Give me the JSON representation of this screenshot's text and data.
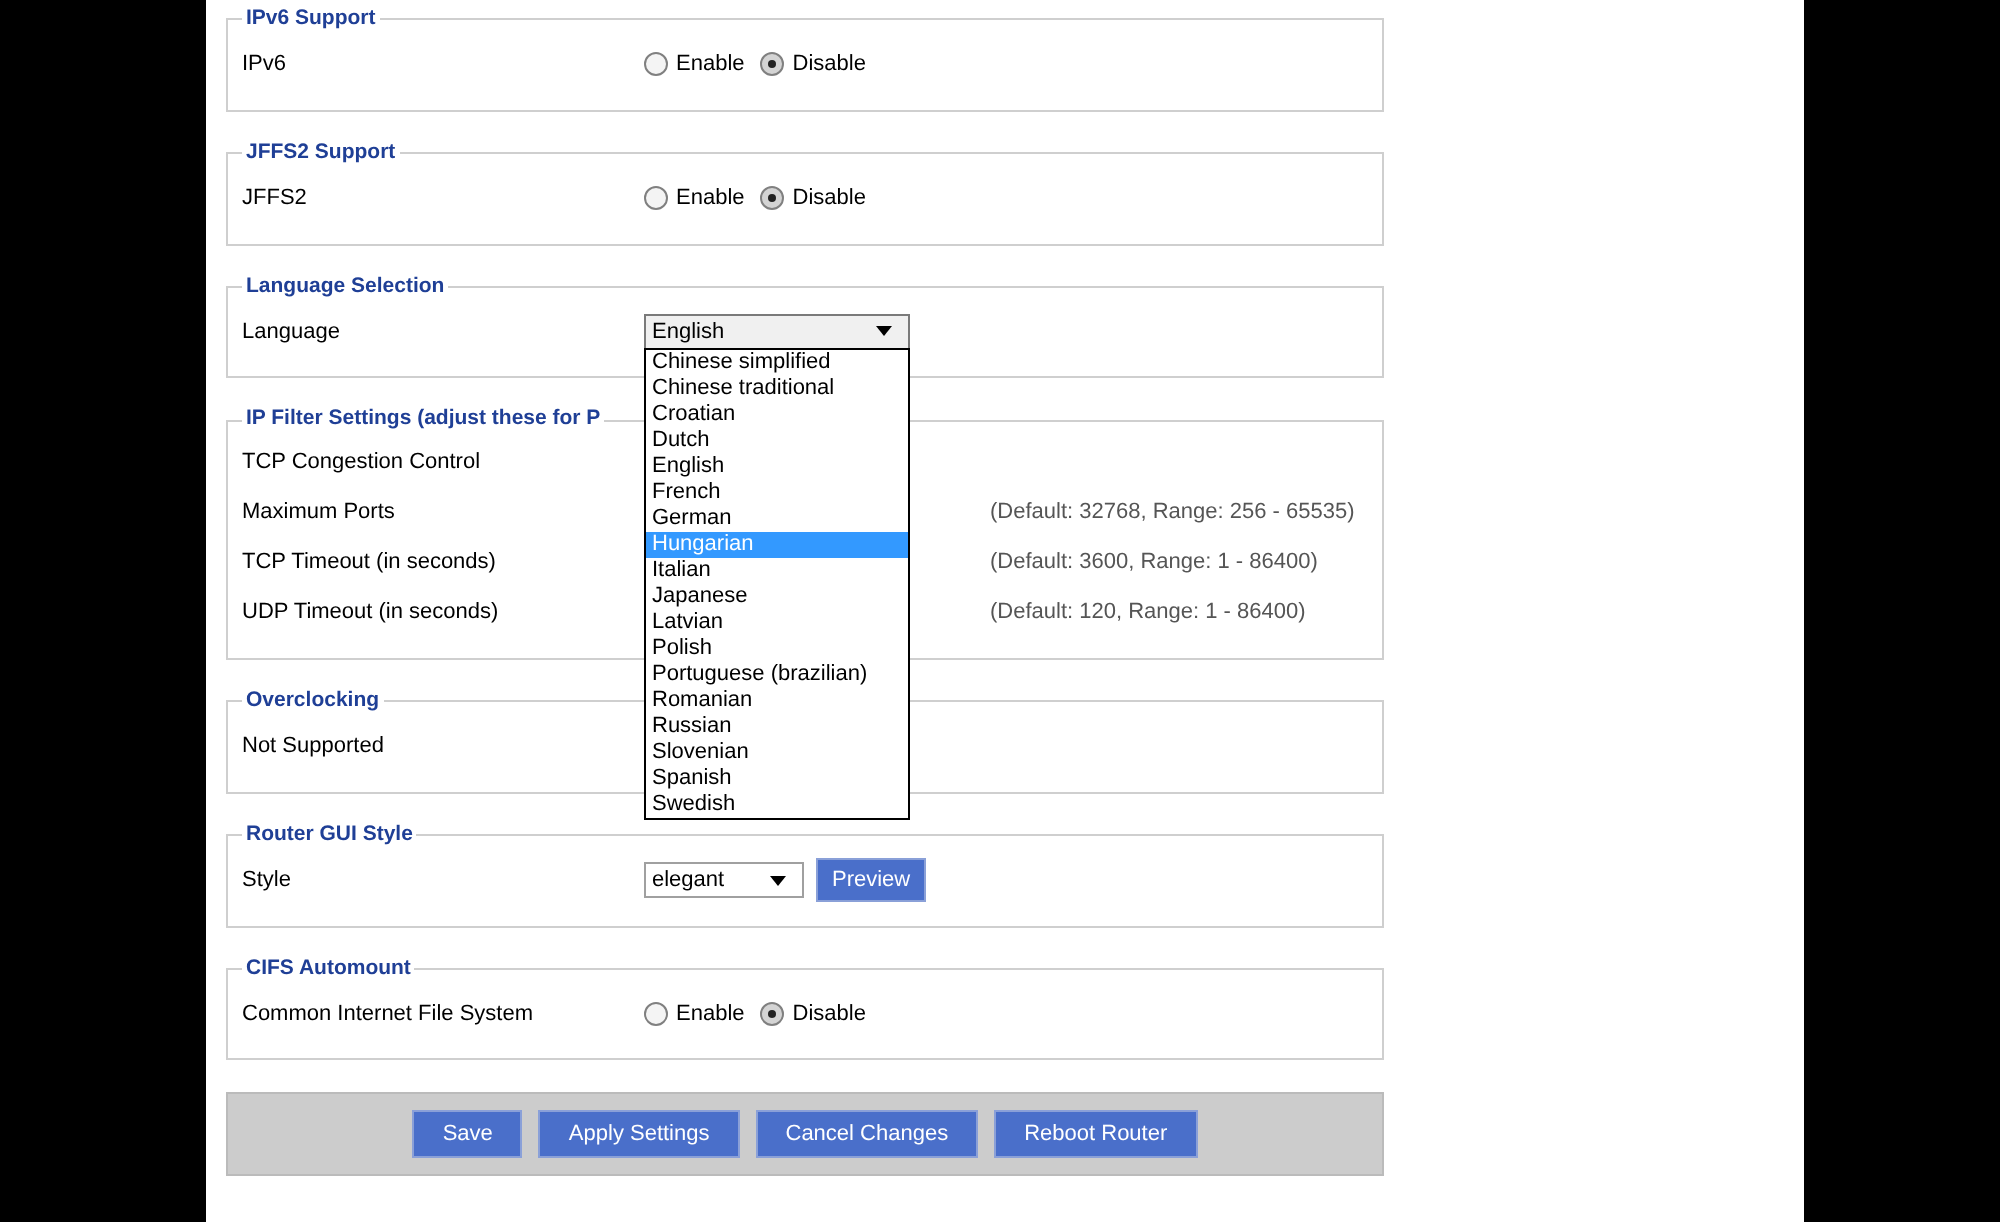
{
  "sections": [
    {
      "legend": "IPv6 Support",
      "rows": [
        {
          "kind": "radio",
          "label": "IPv6",
          "options": [
            {
              "label": "Enable",
              "selected": false
            },
            {
              "label": "Disable",
              "selected": true
            }
          ]
        }
      ]
    },
    {
      "legend": "JFFS2 Support",
      "rows": [
        {
          "kind": "radio",
          "label": "JFFS2",
          "options": [
            {
              "label": "Enable",
              "selected": false
            },
            {
              "label": "Disable",
              "selected": true
            }
          ]
        }
      ]
    },
    {
      "legend": "Language Selection",
      "rows": [
        {
          "kind": "select",
          "label": "Language",
          "value": "English",
          "expanded": true,
          "options": [
            {
              "label": "Chinese simplified",
              "highlighted": false
            },
            {
              "label": "Chinese traditional",
              "highlighted": false
            },
            {
              "label": "Croatian",
              "highlighted": false
            },
            {
              "label": "Dutch",
              "highlighted": false
            },
            {
              "label": "English",
              "highlighted": false
            },
            {
              "label": "French",
              "highlighted": false
            },
            {
              "label": "German",
              "highlighted": false
            },
            {
              "label": "Hungarian",
              "highlighted": true
            },
            {
              "label": "Italian",
              "highlighted": false
            },
            {
              "label": "Japanese",
              "highlighted": false
            },
            {
              "label": "Latvian",
              "highlighted": false
            },
            {
              "label": "Polish",
              "highlighted": false
            },
            {
              "label": "Portuguese (brazilian)",
              "highlighted": false
            },
            {
              "label": "Romanian",
              "highlighted": false
            },
            {
              "label": "Russian",
              "highlighted": false
            },
            {
              "label": "Slovenian",
              "highlighted": false
            },
            {
              "label": "Spanish",
              "highlighted": false
            },
            {
              "label": "Swedish",
              "highlighted": false
            }
          ]
        }
      ]
    },
    {
      "legend": "IP Filter Settings (adjust these for P",
      "rows": [
        {
          "kind": "text",
          "label": "TCP Congestion Control"
        },
        {
          "kind": "hint",
          "label": "Maximum Ports",
          "hint": "(Default: 32768, Range: 256 - 65535)"
        },
        {
          "kind": "hint",
          "label": "TCP Timeout (in seconds)",
          "hint": "(Default: 3600, Range: 1 - 86400)"
        },
        {
          "kind": "hint",
          "label": "UDP Timeout (in seconds)",
          "hint": "(Default: 120, Range: 1 - 86400)"
        }
      ]
    },
    {
      "legend": "Overclocking",
      "rows": [
        {
          "kind": "text",
          "label": "Not Supported"
        }
      ]
    },
    {
      "legend": "Router GUI Style",
      "rows": [
        {
          "kind": "select",
          "label": "Style",
          "value": "elegant",
          "expanded": false,
          "button": "Preview"
        }
      ]
    },
    {
      "legend": "CIFS Automount",
      "rows": [
        {
          "kind": "radio",
          "label": "Common Internet File System",
          "options": [
            {
              "label": "Enable",
              "selected": false
            },
            {
              "label": "Disable",
              "selected": true
            }
          ]
        }
      ]
    }
  ],
  "buttons": [
    "Save",
    "Apply Settings",
    "Cancel Changes",
    "Reboot Router"
  ]
}
